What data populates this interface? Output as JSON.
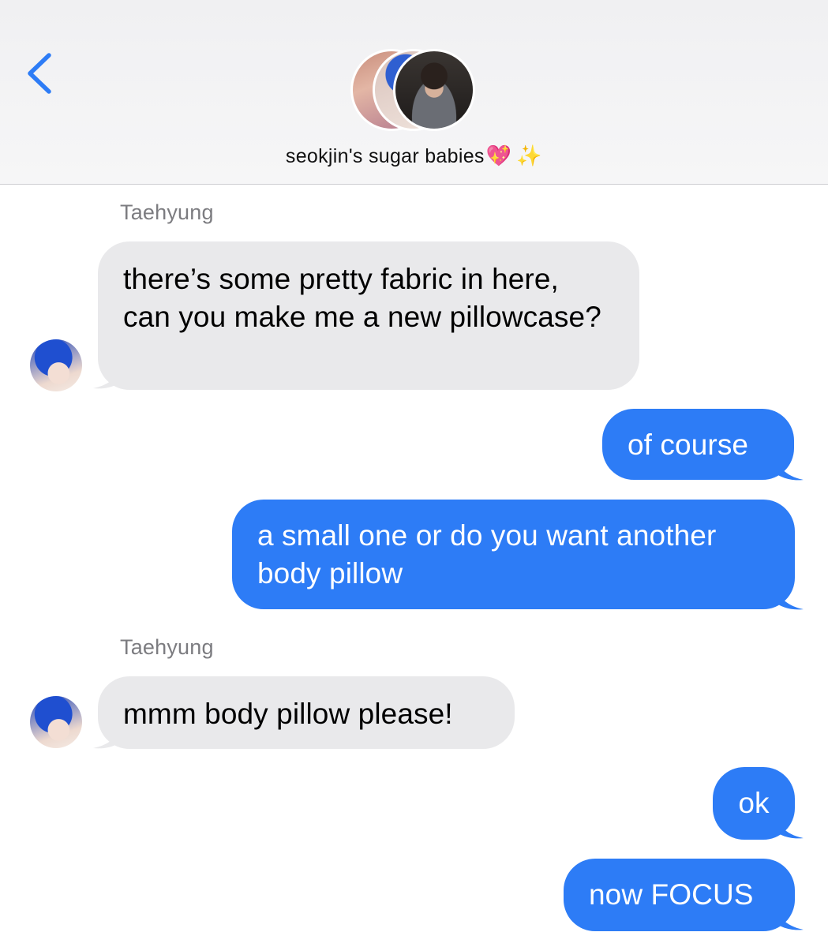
{
  "header": {
    "group_name": "seokjin's sugar babies",
    "heart_emoji": "💖",
    "sparkles_emoji": "✨"
  },
  "colors": {
    "back_arrow": "#2d7cf6",
    "incoming_bubble": "#e9e9eb",
    "outgoing_bubble": "#2d7cf6",
    "sender_label": "#7c7c80"
  },
  "messages": [
    {
      "sender": "Taehyung",
      "text": "there’s some pretty fabric in here, can you make me a new pillowcase?"
    },
    {
      "sender": "me",
      "text": "of course"
    },
    {
      "sender": "me",
      "text": "a small one or do you want another body pillow"
    },
    {
      "sender": "Taehyung",
      "text": "mmm body pillow please!"
    },
    {
      "sender": "me",
      "text": "ok"
    },
    {
      "sender": "me",
      "text": "now FOCUS"
    }
  ]
}
